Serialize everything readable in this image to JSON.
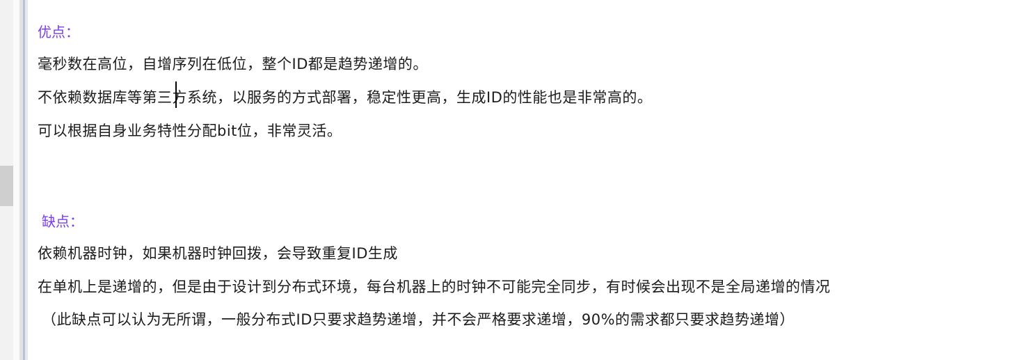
{
  "pros": {
    "heading": "优点：",
    "lines": [
      "毫秒数在高位，自增序列在低位，整个ID都是趋势递增的。",
      "不依赖数据库等第三方系统，以服务的方式部署，稳定性更高，生成ID的性能也是非常高的。",
      "可以根据自身业务特性分配bit位，非常灵活。"
    ]
  },
  "cons": {
    "heading": "缺点：",
    "lines": [
      "依赖机器时钟，如果机器时钟回拨，会导致重复ID生成",
      "在单机上是递增的，但是由于设计到分布式环境，每台机器上的时钟不可能完全同步，有时候会出现不是全局递增的情况",
      "（此缺点可以认为无所谓，一般分布式ID只要求趋势递增，并不会严格要求递增，90%的需求都只要求趋势递增）"
    ]
  },
  "colors": {
    "heading": "#7a3cf0",
    "text": "#1c1c1c"
  }
}
